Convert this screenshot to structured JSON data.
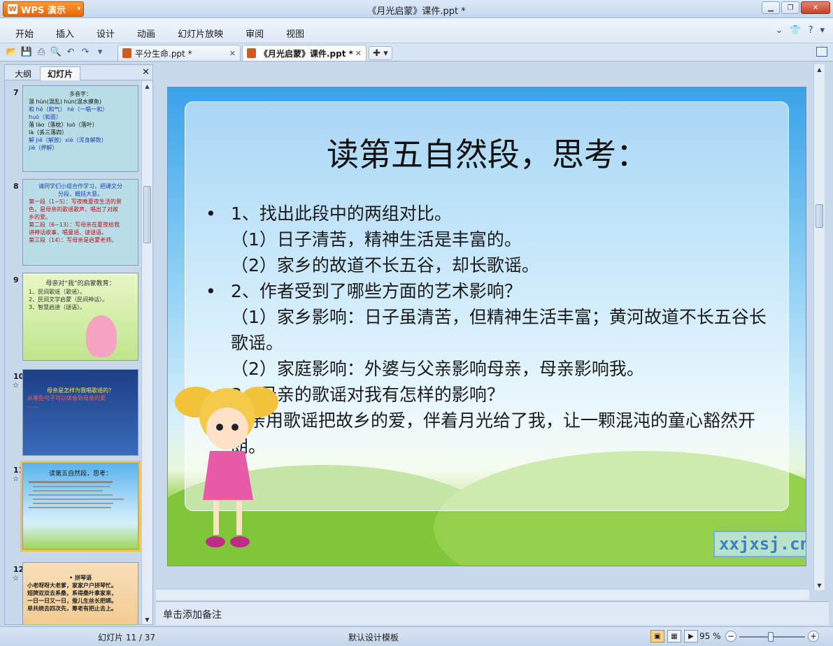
{
  "titlebar": {
    "app_name": "WPS 演示",
    "window_title": "《月光启蒙》课件.ppt *"
  },
  "menu": {
    "items": [
      "开始",
      "插入",
      "设计",
      "动画",
      "幻灯片放映",
      "审阅",
      "视图"
    ]
  },
  "tabs": [
    {
      "label": "平分生命.ppt *"
    },
    {
      "label": "《月光启蒙》课件.ppt *"
    }
  ],
  "left_panel": {
    "tabs": [
      "大纲",
      "幻灯片"
    ],
    "thumbnails": [
      {
        "num": "7",
        "lines": [
          "多音字：",
          "混  hùn(混乱)    hún(混水摸鱼)",
          "和  hé（和气）  hè（一唱一和）",
          "    huó（和面）",
          "落  lào（落枕）luò（落叶）",
          "    là（丢三落四）",
          "解  jiě（解放）xiè（浑身解数）",
          "    jiè（押解）"
        ]
      },
      {
        "num": "8",
        "lines": [
          "请同学们小组合作学习，把课文分",
          "分段，概括大意。",
          "第一段（1~5）：写夜晚夏夜生活的景",
          "色，是母亲的歌谣歌声，唱出了对故",
          "乡的爱。",
          "第二段（6~13）：写母亲在夏夜给我",
          "讲神话故事，唱童谣、谜谜语。",
          "第三段（14）：写母亲是启蒙老师。"
        ]
      },
      {
        "num": "9",
        "lines": [
          "母亲对“我”的启蒙教育：",
          "1、民间歌谣（歌谣）。",
          "2、民间文学启蒙（民间神话）。",
          "3、智慧启迪（谜语）。"
        ]
      },
      {
        "num": "10",
        "lines": [
          "母亲是怎样为我唱歌谣的？",
          "从哪些句子可以体会到母亲的爱",
          "……"
        ]
      },
      {
        "num": "11",
        "lines": [
          "读第五自然段，思考："
        ]
      },
      {
        "num": "12",
        "lines": [
          "• 拼琴语",
          "小老呀呀大老爹，家家户户拼琴忙。",
          "短牌双双去系桑，系得桑叶拿家来，",
          "一日一日又一日，蚕儿生丝长把绑。",
          "单共统去四次先，筹老有把止去上。"
        ]
      }
    ]
  },
  "slide": {
    "title": "读第五自然段，思考：",
    "items": [
      {
        "type": "bullet",
        "text": "1、找出此段中的两组对比。"
      },
      {
        "type": "sub",
        "text": "（1）日子清苦，精神生活是丰富的。"
      },
      {
        "type": "sub",
        "text": "（2）家乡的故道不长五谷，却长歌谣。"
      },
      {
        "type": "bullet",
        "text": "2、作者受到了哪些方面的艺术影响？"
      },
      {
        "type": "sub",
        "text": "（1）家乡影响：日子虽清苦，但精神生活丰富；黄河故道不长五谷长歌谣。"
      },
      {
        "type": "sub",
        "text": "（2）家庭影响：外婆与父亲影响母亲，母亲影响我。"
      },
      {
        "type": "bullet",
        "text": "3、母亲的歌谣对我有怎样的影响？"
      },
      {
        "type": "sub",
        "text": "母亲用歌谣把故乡的爱，伴着月光给了我，让一颗混沌的童心豁然开朗。"
      }
    ],
    "watermark": "xxjxsj.cn"
  },
  "notes": {
    "placeholder": "单击添加备注"
  },
  "status": {
    "slide_indicator": "幻灯片 11 / 37",
    "template": "默认设计模板",
    "zoom": "95 %"
  }
}
